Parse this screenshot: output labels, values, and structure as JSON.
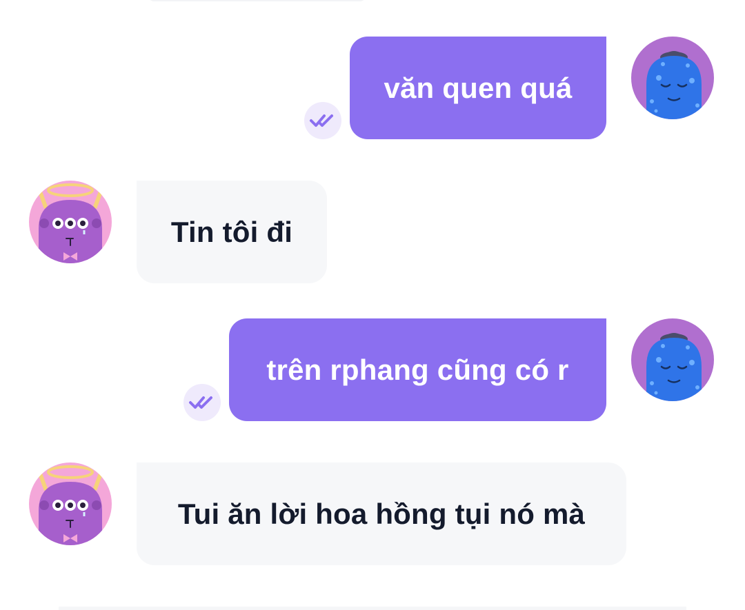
{
  "colors": {
    "outgoing_bubble": "#8b6ff0",
    "incoming_bubble": "#f6f7f9",
    "incoming_text": "#141b2d",
    "tick": "#8b6ff0"
  },
  "messages": [
    {
      "direction": "outgoing",
      "text": "văn quen quá",
      "status_icon": "double-check-icon",
      "avatar": "blue-monster-avatar"
    },
    {
      "direction": "incoming",
      "text": "Tin tôi đi",
      "avatar": "purple-angel-monster-avatar"
    },
    {
      "direction": "outgoing",
      "text": "trên rphang cũng có r",
      "status_icon": "double-check-icon",
      "avatar": "blue-monster-avatar"
    },
    {
      "direction": "incoming",
      "text": "Tui ăn lời hoa hồng tụi nó mà",
      "avatar": "purple-angel-monster-avatar"
    }
  ]
}
